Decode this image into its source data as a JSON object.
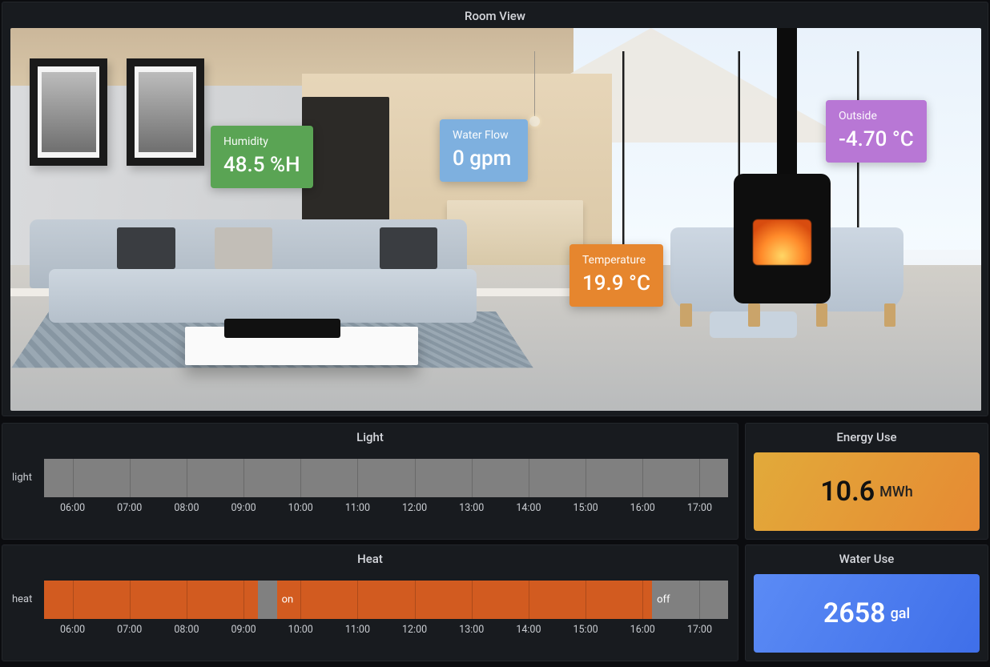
{
  "room_view": {
    "title": "Room View",
    "cards": {
      "humidity": {
        "label": "Humidity",
        "value": "48.5 %H",
        "color": "#5aa454"
      },
      "water_flow": {
        "label": "Water Flow",
        "value": "0 gpm",
        "color": "#7eb0df"
      },
      "temperature": {
        "label": "Temperature",
        "value": "19.9 °C",
        "color": "#e6862e"
      },
      "outside": {
        "label": "Outside",
        "value": "-4.70 °C",
        "color": "#b877d5"
      }
    }
  },
  "light_panel": {
    "title": "Light",
    "row_label": "light"
  },
  "heat_panel": {
    "title": "Heat",
    "row_label": "heat",
    "on_label": "on",
    "off_label": "off"
  },
  "energy_panel": {
    "title": "Energy Use",
    "value": "10.6",
    "unit": "MWh"
  },
  "water_panel": {
    "title": "Water Use",
    "value": "2658",
    "unit": "gal"
  },
  "chart_data": [
    {
      "type": "bar",
      "id": "light-timeline",
      "title": "Light",
      "row": "light",
      "x_range": [
        "05:30",
        "17:30"
      ],
      "x_ticks": [
        "06:00",
        "07:00",
        "08:00",
        "09:00",
        "10:00",
        "11:00",
        "12:00",
        "13:00",
        "14:00",
        "15:00",
        "16:00",
        "17:00"
      ],
      "segments": [
        {
          "state": "off",
          "from": "05:30",
          "to": "17:30"
        }
      ],
      "colors": {
        "on": "#d25b20",
        "off": "#808080"
      }
    },
    {
      "type": "bar",
      "id": "heat-timeline",
      "title": "Heat",
      "row": "heat",
      "x_range": [
        "05:30",
        "17:30"
      ],
      "x_ticks": [
        "06:00",
        "07:00",
        "08:00",
        "09:00",
        "10:00",
        "11:00",
        "12:00",
        "13:00",
        "14:00",
        "15:00",
        "16:00",
        "17:00"
      ],
      "segments": [
        {
          "state": "on",
          "from": "05:30",
          "to": "09:15"
        },
        {
          "state": "off",
          "from": "09:15",
          "to": "09:35"
        },
        {
          "state": "on",
          "from": "09:35",
          "to": "16:10",
          "label": "on"
        },
        {
          "state": "off",
          "from": "16:10",
          "to": "17:30",
          "label": "off"
        }
      ],
      "colors": {
        "on": "#d25b20",
        "off": "#808080"
      }
    }
  ]
}
